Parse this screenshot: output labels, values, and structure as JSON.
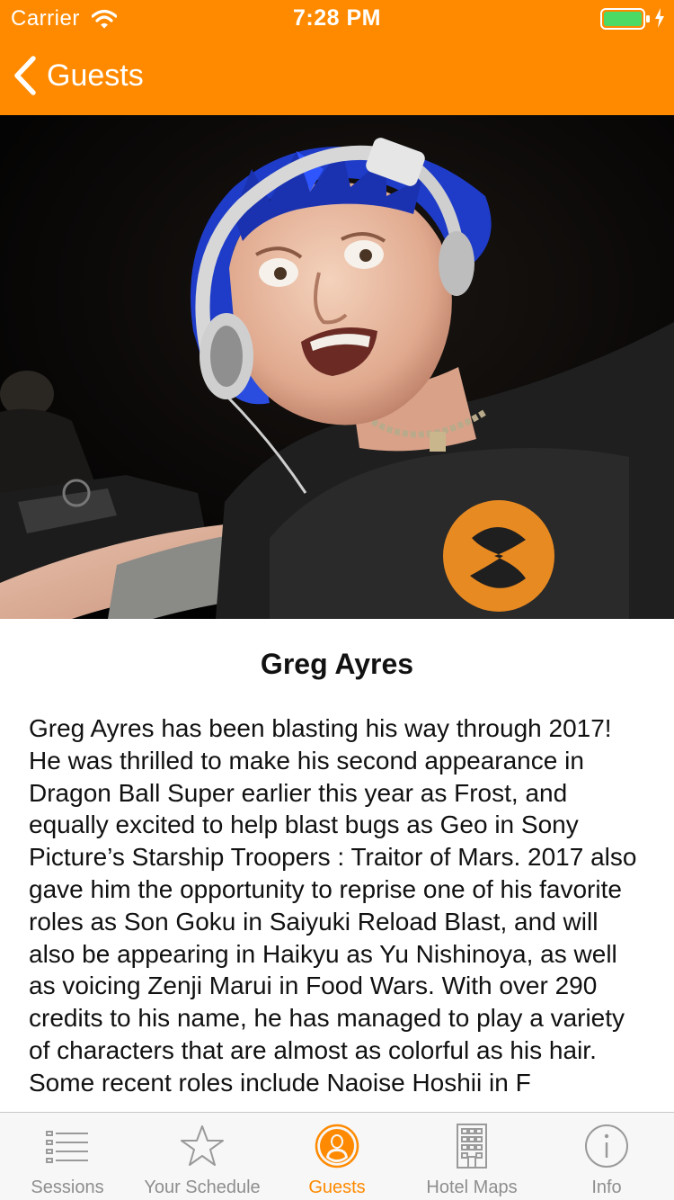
{
  "status_bar": {
    "carrier": "Carrier",
    "time": "7:28 PM",
    "battery_color": "#4cd964"
  },
  "nav": {
    "back_label": "Guests",
    "accent_color": "#ff8a00"
  },
  "guest": {
    "photo_icon": "guest-photo",
    "name": "Greg Ayres",
    "bio": "Greg Ayres has been blasting his way through 2017!  He was thrilled to make his second appearance in Dragon Ball Super earlier this year as Frost, and equally excited to help blast bugs as Geo in Sony Picture’s Starship Troopers : Traitor of Mars. 2017 also gave him the opportunity to reprise one of his favorite roles as Son Goku in Saiyuki Reload Blast, and will also be appearing in Haikyu as Yu Nishinoya, as well as voicing Zenji Marui in Food Wars. With over 290 credits to his name, he has managed to play a variety of characters that are almost as colorful as his hair. Some recent roles include Naoise Hoshii in F"
  },
  "tab_bar": {
    "tabs": [
      {
        "label": "Sessions",
        "icon": "list-icon",
        "active": false
      },
      {
        "label": "Your Schedule",
        "icon": "star-icon",
        "active": false
      },
      {
        "label": "Guests",
        "icon": "person-icon",
        "active": true
      },
      {
        "label": "Hotel Maps",
        "icon": "building-icon",
        "active": false
      },
      {
        "label": "Info",
        "icon": "info-icon",
        "active": false
      }
    ],
    "active_color": "#ff8a00",
    "inactive_color": "#8e8e8e"
  }
}
